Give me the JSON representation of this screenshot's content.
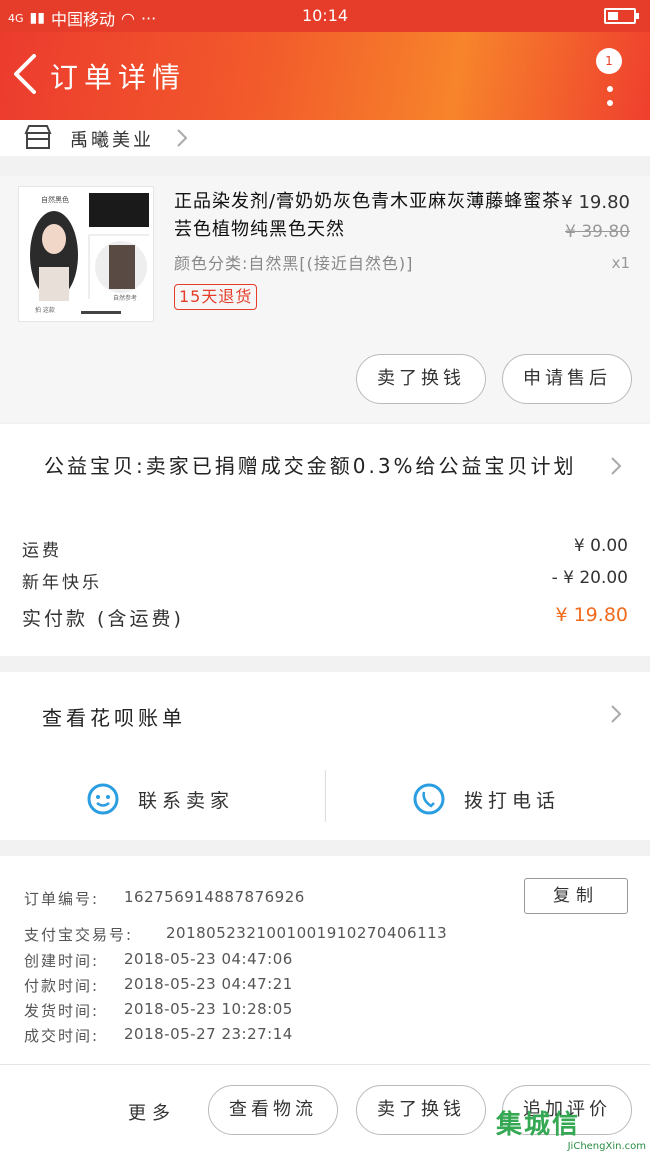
{
  "status": {
    "signal": "4G",
    "carrier": "中国移动",
    "time": "10:14"
  },
  "nav": {
    "title": "订单详情",
    "badge": "1"
  },
  "shop": {
    "name": "禹曦美业"
  },
  "product": {
    "title": "正品染发剂/膏奶奶灰色青木亚麻灰薄藤蜂蜜茶芸色植物纯黑色天然",
    "spec": "颜色分类:自然黑[(接近自然色)]",
    "tag": "15天退货",
    "price": "¥ 19.80",
    "original_price": "¥ 39.80",
    "quantity": "x1",
    "thumb": {
      "caption": "自然黑色",
      "sub": "拍 这款",
      "note": "自然参考"
    },
    "buttons": {
      "resell": "卖了换钱",
      "after_sale": "申请售后"
    }
  },
  "charity": {
    "text": "公益宝贝:卖家已捐赠成交金额0.3%给公益宝贝计划"
  },
  "fees": {
    "shipping_label": "运费",
    "shipping_value": "¥ 0.00",
    "discount_label": "新年快乐",
    "discount_value": "- ¥ 20.00",
    "total_label": "实付款 (含运费)",
    "total_value": "¥ 19.80"
  },
  "bill": {
    "label": "查看花呗账单",
    "contact_seller": "联系卖家",
    "call": "拨打电话"
  },
  "order": {
    "copy": "复制",
    "number_label": "订单编号:",
    "number": "162756914887876926",
    "alipay_label": "支付宝交易号:",
    "alipay": "2018052321001001910270406113",
    "created_label": "创建时间:",
    "created": "2018-05-23 04:47:06",
    "paid_label": "付款时间:",
    "paid": "2018-05-23 04:47:21",
    "shipped_label": "发货时间:",
    "shipped": "2018-05-23 10:28:05",
    "completed_label": "成交时间:",
    "completed": "2018-05-27 23:27:14"
  },
  "bottom": {
    "more": "更多",
    "logistics": "查看物流",
    "resell": "卖了换钱",
    "review": "追加评价"
  },
  "watermark": {
    "top": "集城信",
    "bottom": "JiChengXin.com"
  },
  "colors": {
    "brand": "#e53d2a",
    "price": "#f26b1d",
    "contact_icon": "#2a9ee0"
  }
}
